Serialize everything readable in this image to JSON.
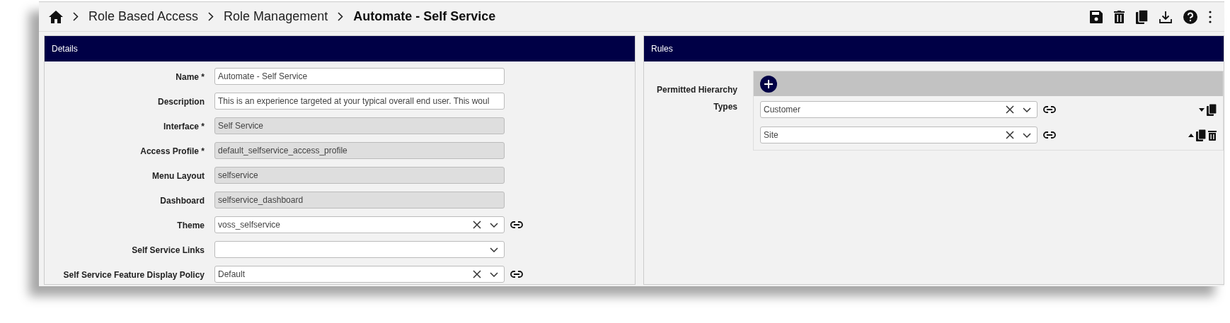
{
  "breadcrumb": [
    {
      "label": "Role Based Access",
      "current": false
    },
    {
      "label": "Role Management",
      "current": false
    },
    {
      "label": "Automate - Self Service",
      "current": true
    }
  ],
  "details": {
    "title": "Details",
    "fields": [
      {
        "label": "Name *",
        "kind": "text",
        "value": "Automate - Self Service"
      },
      {
        "label": "Description",
        "kind": "text",
        "value": "This is an experience targeted at your typical overall end user. This woul"
      },
      {
        "label": "Interface *",
        "kind": "readonly",
        "value": "Self Service"
      },
      {
        "label": "Access Profile *",
        "kind": "readonly",
        "value": "default_selfservice_access_profile"
      },
      {
        "label": "Menu Layout",
        "kind": "readonly",
        "value": "selfservice"
      },
      {
        "label": "Dashboard",
        "kind": "readonly",
        "value": "selfservice_dashboard"
      },
      {
        "label": "Theme",
        "kind": "select",
        "value": "voss_selfservice",
        "clearable": true,
        "linked": true
      },
      {
        "label": "Self Service Links",
        "kind": "select",
        "clearable": false,
        "linked": false
      },
      {
        "label": "Self Service Feature Display Policy",
        "kind": "select",
        "value": "Default",
        "clearable": true,
        "linked": true
      }
    ]
  },
  "rules": {
    "title": "Rules",
    "label": "Permitted Hierarchy Types",
    "items": [
      {
        "value": "Customer",
        "can_move_up": false,
        "can_move_down": true,
        "can_delete": false
      },
      {
        "value": "Site",
        "can_move_up": true,
        "can_move_down": false,
        "can_delete": true
      }
    ]
  }
}
